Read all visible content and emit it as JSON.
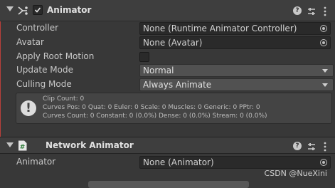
{
  "animator": {
    "title": "Animator",
    "enabled": true,
    "icons": [
      "animator-icon",
      "help-icon",
      "preset-icon",
      "more-menu-icon"
    ],
    "fields": {
      "controller": {
        "label": "Controller",
        "value": "None (Runtime Animator Controller)"
      },
      "avatar": {
        "label": "Avatar",
        "value": "None (Avatar)"
      },
      "apply_root_motion": {
        "label": "Apply Root Motion",
        "checked": false
      },
      "update_mode": {
        "label": "Update Mode",
        "value": "Normal"
      },
      "culling_mode": {
        "label": "Culling Mode",
        "value": "Always Animate"
      }
    },
    "info": {
      "line1": "Clip Count: 0",
      "line2": "Curves Pos: 0 Quat: 0 Euler: 0 Scale: 0 Muscles: 0 Generic: 0 PPtr: 0",
      "line3": "Curves Count: 0 Constant: 0 (0.0%) Dense: 0 (0.0%) Stream: 0 (0.0%)"
    }
  },
  "network_animator": {
    "title": "Network Animator",
    "icons": [
      "script-icon",
      "help-icon",
      "preset-icon",
      "more-menu-icon"
    ],
    "fields": {
      "animator": {
        "label": "Animator",
        "value": "None (Animator)"
      }
    }
  },
  "watermark": "CSDN @NueXini",
  "colors": {
    "background": "#383838",
    "header": "#3e3e3e",
    "field": "#2a2a2a",
    "accent_bar": "#b93f3a"
  }
}
